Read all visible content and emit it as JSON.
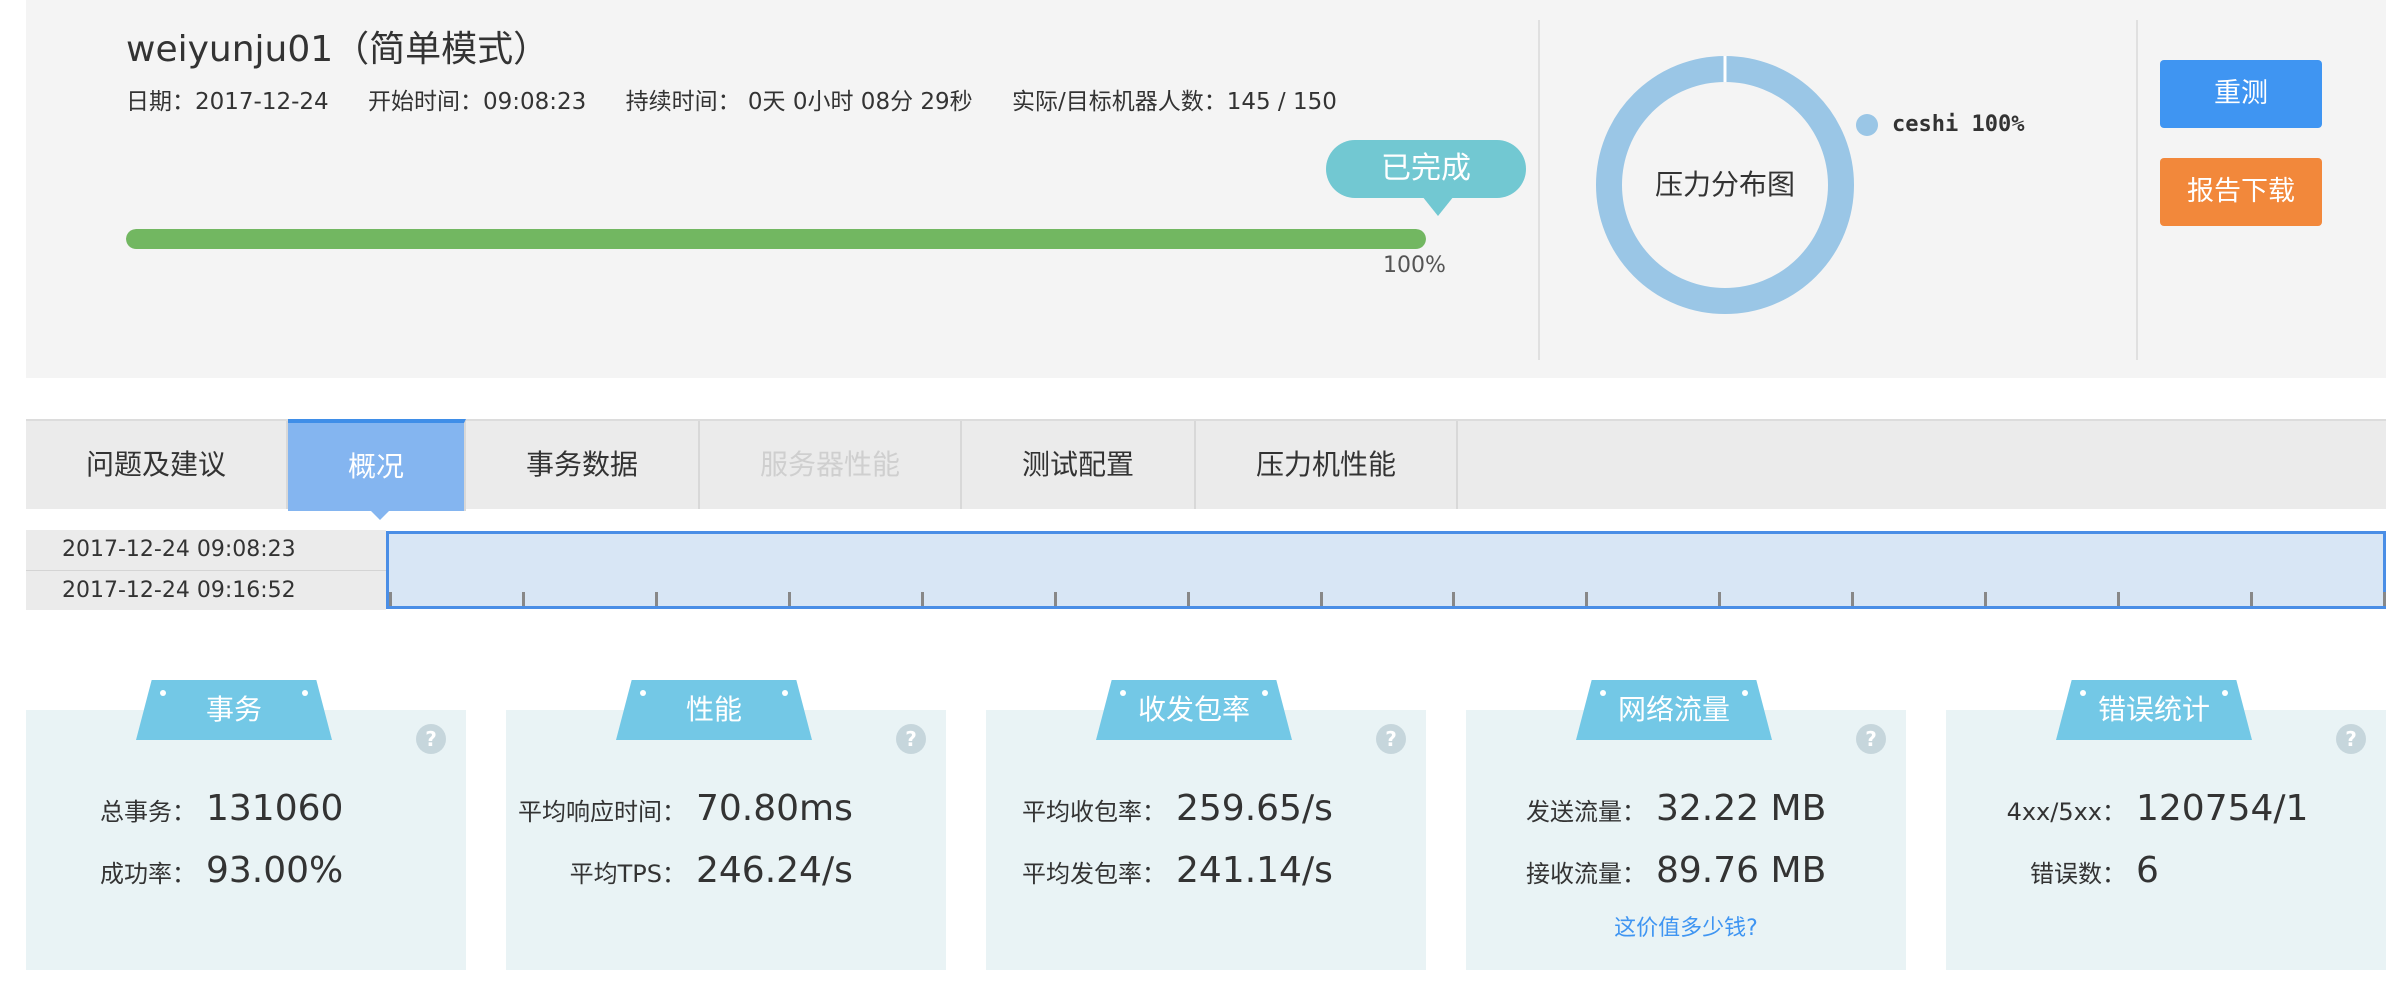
{
  "test": {
    "title": "weiyunju01（简单模式）",
    "date": "日期：2017-12-24",
    "start_time": "开始时间：09:08:23",
    "duration": "持续时间： 0天 0小时 08分 29秒",
    "machines": "实际/目标机器人数：145 / 150",
    "status": "已完成",
    "progress_label": "100%",
    "progress_fraction": 1.0,
    "progress_color": "#72b761"
  },
  "pressure_chart": {
    "center_label": "压力分布图",
    "legend": "ceshi 100%",
    "slice_color": "#9ac6e6"
  },
  "buttons": {
    "retest": "重测",
    "download": "报告下载"
  },
  "tabs": [
    {
      "label": "问题及建议",
      "state": "normal"
    },
    {
      "label": "概况",
      "state": "active"
    },
    {
      "label": "事务数据",
      "state": "normal"
    },
    {
      "label": "服务器性能",
      "state": "disabled"
    },
    {
      "label": "测试配置",
      "state": "normal"
    },
    {
      "label": "压力机性能",
      "state": "normal"
    }
  ],
  "time_range": {
    "start": "2017-12-24 09:08:23",
    "end": "2017-12-24 09:16:52"
  },
  "cards": [
    {
      "title": "事务",
      "rows": [
        {
          "label": "总事务：",
          "value": "131060"
        },
        {
          "label": "成功率：",
          "value": "93.00%"
        }
      ]
    },
    {
      "title": "性能",
      "rows": [
        {
          "label": "平均响应时间：",
          "value": "70.80ms"
        },
        {
          "label": "平均TPS：",
          "value": "246.24/s"
        }
      ]
    },
    {
      "title": "收发包率",
      "rows": [
        {
          "label": "平均收包率：",
          "value": "259.65/s"
        },
        {
          "label": "平均发包率：",
          "value": "241.14/s"
        }
      ]
    },
    {
      "title": "网络流量",
      "rows": [
        {
          "label": "发送流量：",
          "value": "32.22 MB"
        },
        {
          "label": "接收流量：",
          "value": "89.76 MB"
        }
      ],
      "link": "这价值多少钱?"
    },
    {
      "title": "错误统计",
      "rows": [
        {
          "label": "4xx/5xx：",
          "value": "120754/1"
        },
        {
          "label": "错误数：",
          "value": "6"
        }
      ]
    }
  ],
  "colors": {
    "accent_blue": "#3f95f2",
    "accent_orange": "#f2883b",
    "card_header": "#73c8e6",
    "card_bg": "#e9f3f5"
  }
}
